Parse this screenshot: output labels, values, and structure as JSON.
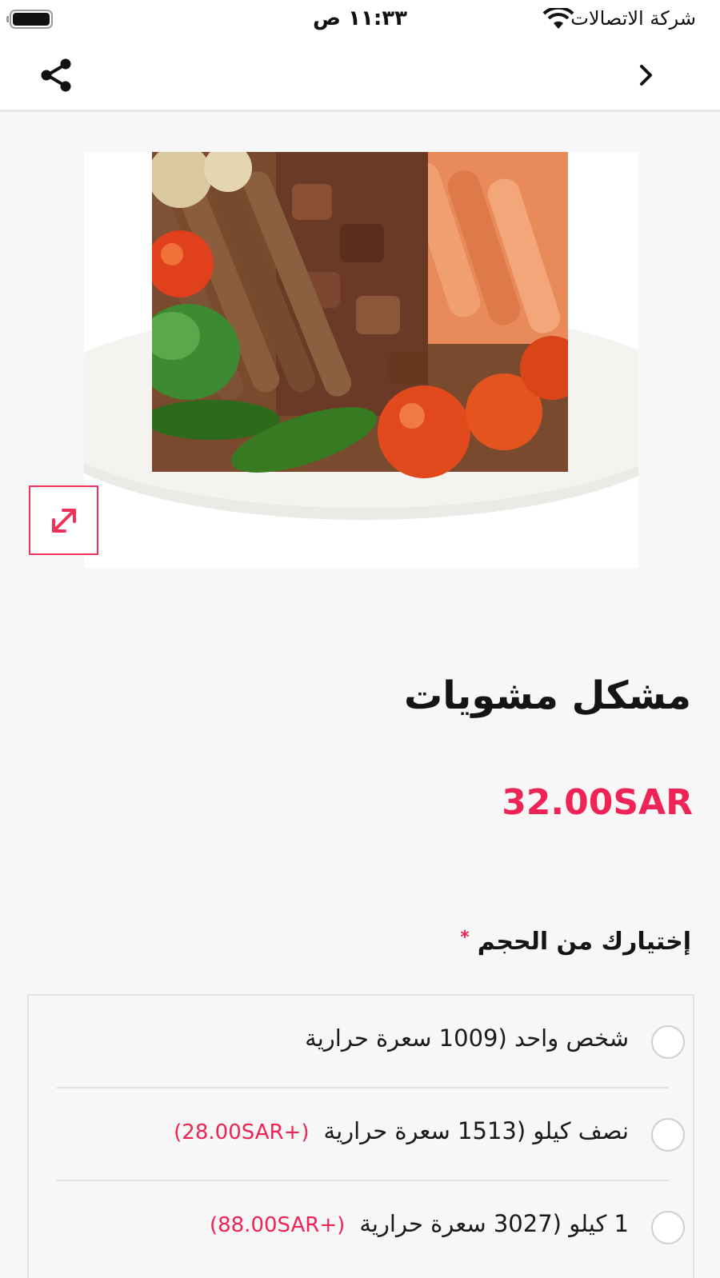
{
  "status_bar": {
    "time": "١١:٣٣ ص",
    "carrier": "شركة الاتصالات"
  },
  "product": {
    "title": "مشكل مشويات",
    "price": "32.00SAR",
    "image_alt": "mixed grill platter"
  },
  "size_section": {
    "label": "إختيارك من الحجم",
    "required_mark": "*",
    "options": [
      {
        "label": "شخص واحد (1009 سعرة حرارية",
        "extra": "",
        "selected": false
      },
      {
        "label": "نصف كيلو (1513 سعرة حرارية",
        "extra": "(+28.00SAR)",
        "selected": false
      },
      {
        "label": "1 كيلو (3027 سعرة حرارية",
        "extra": "(+88.00SAR)",
        "selected": false
      }
    ]
  },
  "colors": {
    "accent": "#ef2456",
    "background": "#f7f7f7"
  },
  "icons": {
    "share": "share-icon",
    "back": "chevron-right-icon",
    "expand": "expand-icon",
    "wifi": "wifi-icon",
    "battery": "battery-icon"
  }
}
